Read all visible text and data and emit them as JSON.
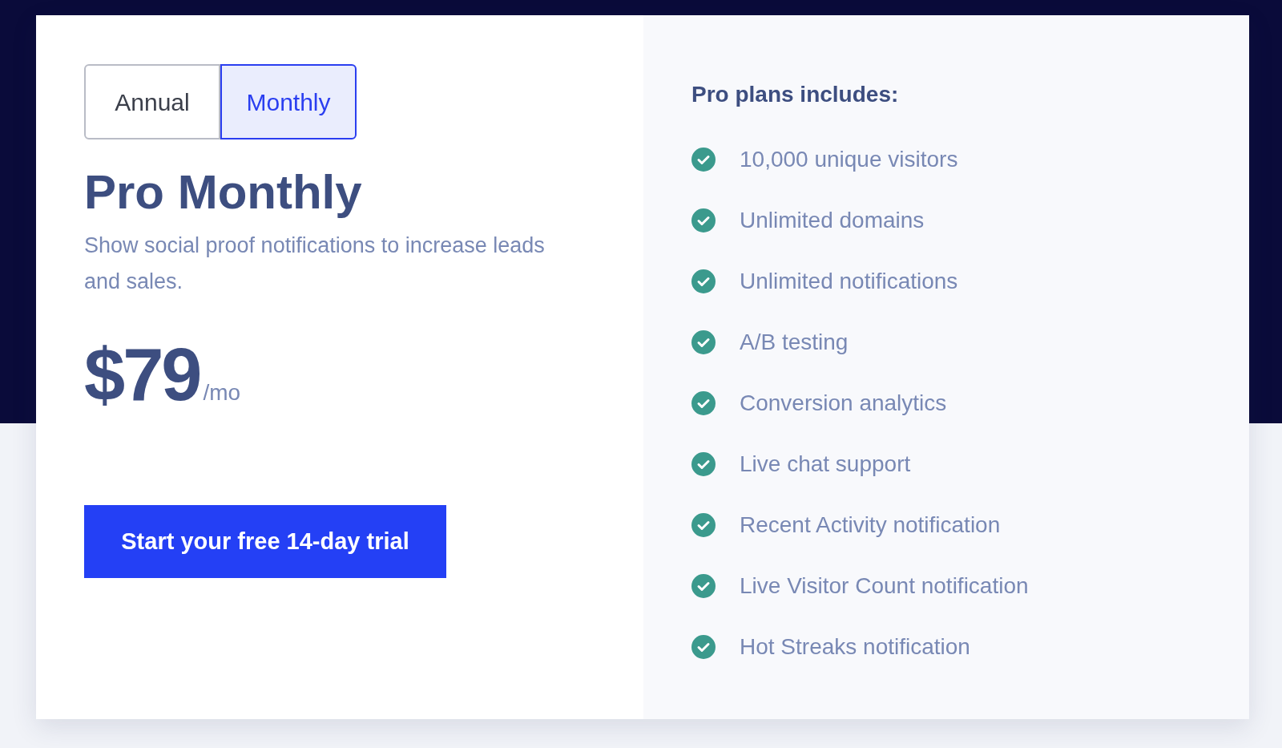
{
  "billing_toggle": [
    {
      "label": "Annual",
      "selected": false
    },
    {
      "label": "Monthly",
      "selected": true
    }
  ],
  "plan": {
    "title": "Pro Monthly",
    "description": "Show social proof notifications to increase leads and sales.",
    "price": "$79",
    "period": "/mo",
    "cta": "Start your free 14-day trial"
  },
  "includes": {
    "heading": "Pro plans includes:",
    "features": [
      "10,000 unique visitors",
      "Unlimited domains",
      "Unlimited notifications",
      "A/B testing",
      "Conversion analytics",
      "Live chat support",
      "Recent Activity notification",
      "Live Visitor Count notification",
      "Hot Streaks notification"
    ]
  }
}
